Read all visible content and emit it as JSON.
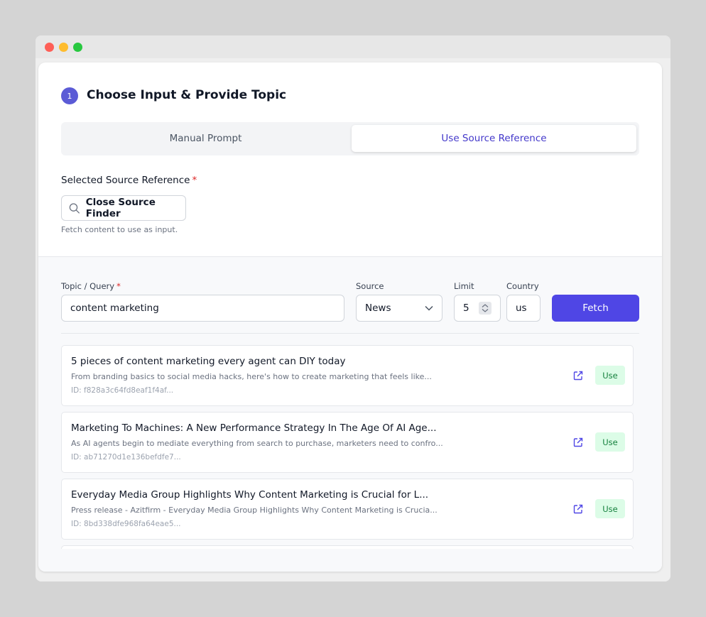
{
  "step": {
    "number": "1",
    "title": "Choose Input & Provide Topic"
  },
  "tabs": {
    "manual": "Manual Prompt",
    "source": "Use Source Reference"
  },
  "source_reference": {
    "label": "Selected Source Reference",
    "required": "*",
    "finder_button": "Close Source Finder",
    "helper": "Fetch content to use as input."
  },
  "finder": {
    "topic_label": "Topic / Query",
    "topic_required": "*",
    "topic_value": "content marketing",
    "source_label": "Source",
    "source_value": "News",
    "limit_label": "Limit",
    "limit_value": "5",
    "country_label": "Country",
    "country_value": "us",
    "fetch_label": "Fetch"
  },
  "results": [
    {
      "title": "5 pieces of content marketing every agent can DIY today",
      "desc": "From branding basics to social media hacks, here's how to create marketing that feels like...",
      "id": "ID: f828a3c64fd8eaf1f4af...",
      "use": "Use"
    },
    {
      "title": "Marketing To Machines: A New Performance Strategy In The Age Of AI Age...",
      "desc": "As AI agents begin to mediate everything from search to purchase, marketers need to confro...",
      "id": "ID: ab71270d1e136befdfe7...",
      "use": "Use"
    },
    {
      "title": "Everyday Media Group Highlights Why Content Marketing is Crucial for L...",
      "desc": "Press release - Azitfirm - Everyday Media Group Highlights Why Content Marketing is Crucia...",
      "id": "ID: 8bd338dfe968fa64eae5...",
      "use": "Use"
    }
  ],
  "colors": {
    "accent": "#4f46e5",
    "use_bg": "#dcfce7",
    "use_text": "#15803d"
  }
}
